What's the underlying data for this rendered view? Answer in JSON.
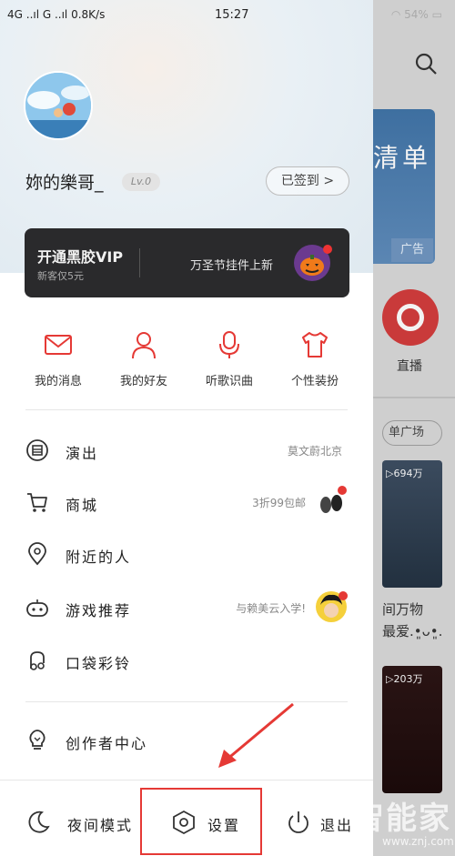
{
  "status_bar": {
    "network": "4G ..ıl  G ..ıl  0.8K/s",
    "time": "15:27",
    "battery": "54%"
  },
  "profile": {
    "username": "妳的樂哥_",
    "level": "Lv.0",
    "signin_label": "已签到 >"
  },
  "vip": {
    "title": "开通黑胶VIP",
    "subtitle": "新客仅5元",
    "promo": "万圣节挂件上新"
  },
  "quick_actions": [
    {
      "label": "我的消息",
      "icon": "mail-icon"
    },
    {
      "label": "我的好友",
      "icon": "person-icon"
    },
    {
      "label": "听歌识曲",
      "icon": "mic-icon"
    },
    {
      "label": "个性装扮",
      "icon": "tshirt-icon"
    }
  ],
  "menu": [
    {
      "label": "演出",
      "right": "莫文蔚北京",
      "icon": "ticket-icon"
    },
    {
      "label": "商城",
      "right": "3折99包邮",
      "icon": "cart-icon"
    },
    {
      "label": "附近的人",
      "right": "",
      "icon": "location-icon"
    },
    {
      "label": "游戏推荐",
      "right": "与赖美云入学!",
      "icon": "gamepad-icon"
    },
    {
      "label": "口袋彩铃",
      "right": "",
      "icon": "bell-music-icon"
    }
  ],
  "creator": {
    "label": "创作者中心",
    "icon": "lightbulb-icon"
  },
  "bottom_bar": {
    "night_mode": "夜间模式",
    "settings": "设置",
    "logout": "退出"
  },
  "background_app": {
    "banner_text": "清单",
    "ad_label": "广告",
    "live_label": "直播",
    "plaza_label": "单广场",
    "card1_plays": "▷694万",
    "card1_text": "间万物\n最爱.•͈ᴗ•͈.",
    "card2_plays": "▷203万"
  },
  "watermark": {
    "text": "智能家",
    "url": "www.znj.com"
  },
  "colors": {
    "accent": "#e53935",
    "vip_bg": "#2a2a2c"
  }
}
